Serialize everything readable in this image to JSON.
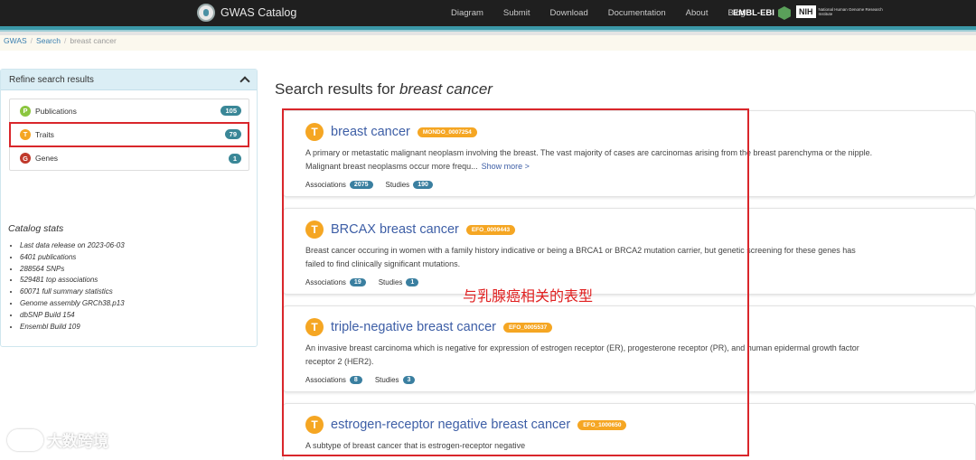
{
  "nav": {
    "logo_text": "GWAS Catalog",
    "links": [
      "Diagram",
      "Submit",
      "Download",
      "Documentation",
      "About",
      "Blog"
    ],
    "embl": "EMBL-EBI",
    "nih_box": "NIH",
    "nih_text": "National Human Genome Research Institute"
  },
  "breadcrumb": [
    "GWAS",
    "Search",
    "breast cancer"
  ],
  "refine": {
    "title": "Refine search results",
    "facets": [
      {
        "icon": "P",
        "label": "Publications",
        "count": "105",
        "color": "#8cc63f"
      },
      {
        "icon": "T",
        "label": "Traits",
        "count": "79",
        "color": "#f5a623"
      },
      {
        "icon": "G",
        "label": "Genes",
        "count": "1",
        "color": "#c0392b"
      }
    ]
  },
  "stats": {
    "title": "Catalog stats",
    "items": [
      "Last data release on 2023-06-03",
      "6401 publications",
      "288564 SNPs",
      "529481 top associations",
      "60071 full summary statistics",
      "Genome assembly GRCh38.p13",
      "dbSNP Build 154",
      "Ensembl Build 109"
    ]
  },
  "page_title": {
    "prefix": "Search results for ",
    "query": "breast cancer"
  },
  "results": [
    {
      "icon": "T",
      "name": "breast cancer",
      "id": "MONDO_0007254",
      "desc1": "A primary or metastatic malignant neoplasm involving the breast. The vast majority of cases are carcinomas arising from the breast parenchyma or the nipple.",
      "desc2": "Malignant breast neoplasms occur more frequ...",
      "more": "Show more >",
      "assoc_label": "Associations",
      "assoc": "2075",
      "studies_label": "Studies",
      "studies": "190"
    },
    {
      "icon": "T",
      "name": "BRCAX breast cancer",
      "id": "EFO_0009443",
      "desc1": "Breast cancer occuring in women with a family history indicative or being a BRCA1 or BRCA2 mutation carrier, but genetic screening for these genes has",
      "desc2": "failed to find clinically significant mutations.",
      "assoc_label": "Associations",
      "assoc": "19",
      "studies_label": "Studies",
      "studies": "1"
    },
    {
      "icon": "T",
      "name": "triple-negative breast cancer",
      "id": "EFO_0005537",
      "desc1": "An invasive breast carcinoma which is negative for expression of estrogen receptor (ER), progesterone receptor (PR), and human epidermal growth factor",
      "desc2": "receptor 2 (HER2).",
      "assoc_label": "Associations",
      "assoc": "8",
      "studies_label": "Studies",
      "studies": "3"
    },
    {
      "icon": "T",
      "name": "estrogen-receptor negative breast cancer",
      "id": "EFO_1000650",
      "desc1": "A subtype of breast cancer that is estrogen-receptor negative"
    }
  ],
  "annotation": "与乳腺癌相关的表型",
  "watermark": "大数跨境",
  "colors": {
    "highlight": "#d9262b",
    "trait": "#f5a623",
    "link": "#3d5ea6",
    "accent": "#3b98a8"
  }
}
